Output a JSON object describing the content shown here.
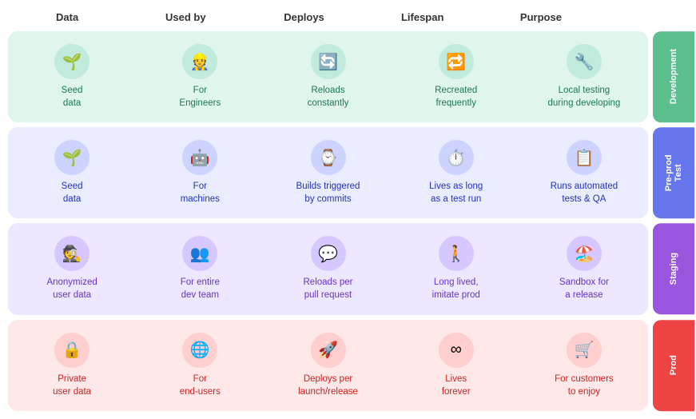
{
  "headers": [
    "Data",
    "Used by",
    "Deploys",
    "Lifespan",
    "Purpose"
  ],
  "rows": [
    {
      "env": "dev",
      "tag": "Development",
      "cells": [
        {
          "icon": "🌱",
          "label": "Seed\ndata"
        },
        {
          "icon": "👷",
          "label": "For\nEngineers"
        },
        {
          "icon": "🔄",
          "label": "Reloads\nconstantly"
        },
        {
          "icon": "🔁",
          "label": "Recreated\nfrequently"
        },
        {
          "icon": "🔧",
          "label": "Local testing\nduring developing"
        }
      ]
    },
    {
      "env": "test",
      "tag": "Pre-prod / Test",
      "cells": [
        {
          "icon": "🌱",
          "label": "Seed\ndata"
        },
        {
          "icon": "🤖",
          "label": "For\nmachines"
        },
        {
          "icon": "⌚",
          "label": "Builds triggered\nby commits"
        },
        {
          "icon": "⏱️",
          "label": "Lives as long\nas a test run"
        },
        {
          "icon": "📋",
          "label": "Runs automated\ntests & QA"
        }
      ]
    },
    {
      "env": "staging",
      "tag": "Staging",
      "cells": [
        {
          "icon": "🕵️",
          "label": "Anonymized\nuser data"
        },
        {
          "icon": "👥",
          "label": "For entire\ndev team"
        },
        {
          "icon": "💬",
          "label": "Reloads per\npull request"
        },
        {
          "icon": "🚶",
          "label": "Long lived,\nimitate prod"
        },
        {
          "icon": "🏖️",
          "label": "Sandbox for\na release"
        }
      ]
    },
    {
      "env": "prod",
      "tag": "Prod",
      "cells": [
        {
          "icon": "🔒",
          "label": "Private\nuser data"
        },
        {
          "icon": "🌐",
          "label": "For\nend-users"
        },
        {
          "icon": "🚀",
          "label": "Deploys per\nlaunch/release"
        },
        {
          "icon": "∞",
          "label": "Lives\nforever"
        },
        {
          "icon": "🛒",
          "label": "For customers\nto enjoy"
        }
      ]
    }
  ]
}
